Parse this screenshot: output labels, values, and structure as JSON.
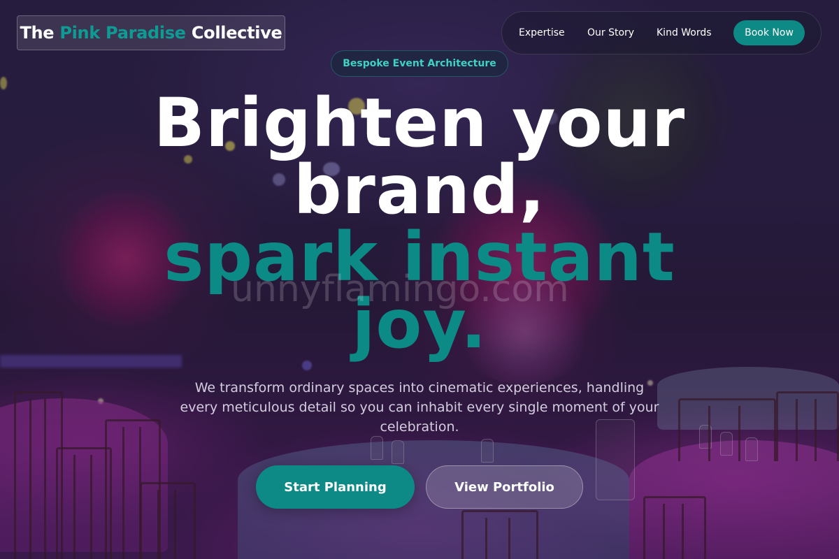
{
  "brand": {
    "prefix": "The ",
    "accent": "Pink Paradise",
    "suffix": " Collective"
  },
  "nav": {
    "items": [
      {
        "label": "Expertise"
      },
      {
        "label": "Our Story"
      },
      {
        "label": "Kind Words"
      }
    ],
    "cta_label": "Book Now"
  },
  "hero": {
    "badge": "Bespoke Event Architecture",
    "headline_line1": "Brighten your",
    "headline_line2": "brand,",
    "headline_line3": "spark instant",
    "headline_line4": "joy.",
    "subtext": "We transform ordinary spaces into cinematic experiences, handling every meticulous detail so you can inhabit every single moment of your celebration.",
    "primary_cta": "Start Planning",
    "secondary_cta": "View Portfolio"
  },
  "watermark": "unnyflamingo.com",
  "colors": {
    "accent_teal": "#0d8a86",
    "badge_text": "#3fd1c4",
    "text_white": "#ffffff"
  }
}
